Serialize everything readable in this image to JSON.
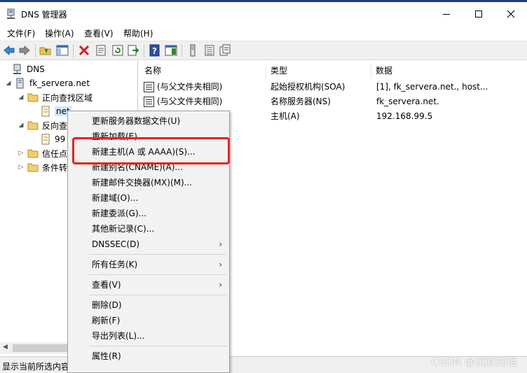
{
  "window": {
    "title": "DNS 管理器"
  },
  "menubar": [
    {
      "label": "文件(F)"
    },
    {
      "label": "操作(A)"
    },
    {
      "label": "查看(V)"
    },
    {
      "label": "帮助(H)"
    }
  ],
  "tree": {
    "root": "DNS",
    "server": "fk_servera.net",
    "forward_zones": "正向查找区域",
    "zone_net": "net",
    "reverse_zones": "反向查",
    "reverse_zone_99": "99",
    "trust_points": "信任点",
    "conditional_forwarders": "条件转"
  },
  "table": {
    "columns": [
      "名称",
      "类型",
      "数据"
    ],
    "rows": [
      {
        "name": "(与父文件夹相同)",
        "type": "起始授权机构(SOA)",
        "data": "[1], fk_servera.net., host..."
      },
      {
        "name": "(与父文件夹相同)",
        "type": "名称服务器(NS)",
        "data": "fk_servera.net."
      },
      {
        "name": "",
        "type": "主机(A)",
        "data": "192.168.99.5"
      }
    ]
  },
  "context_menu": {
    "items": [
      {
        "label": "更新服务器数据文件(U)"
      },
      {
        "label": "重新加载(E)"
      },
      {
        "label": "新建主机(A 或 AAAA)(S)..."
      },
      {
        "label": "新建别名(CNAME)(A)..."
      },
      {
        "label": "新建邮件交换器(MX)(M)..."
      },
      {
        "label": "新建域(O)..."
      },
      {
        "label": "新建委派(G)..."
      },
      {
        "label": "其他新记录(C)..."
      },
      {
        "label": "DNSSEC(D)"
      },
      {
        "label": "所有任务(K)"
      },
      {
        "label": "查看(V)"
      },
      {
        "label": "删除(D)"
      },
      {
        "label": "刷新(F)"
      },
      {
        "label": "导出列表(L)..."
      },
      {
        "label": "属性(R)"
      }
    ],
    "submenu_arrow": "›"
  },
  "status": {
    "text": "显示当前所选内容"
  },
  "watermark": "CSDN @沉默的泪",
  "colors": {
    "highlight": "#e8231c",
    "selection": "#cce8ff"
  }
}
